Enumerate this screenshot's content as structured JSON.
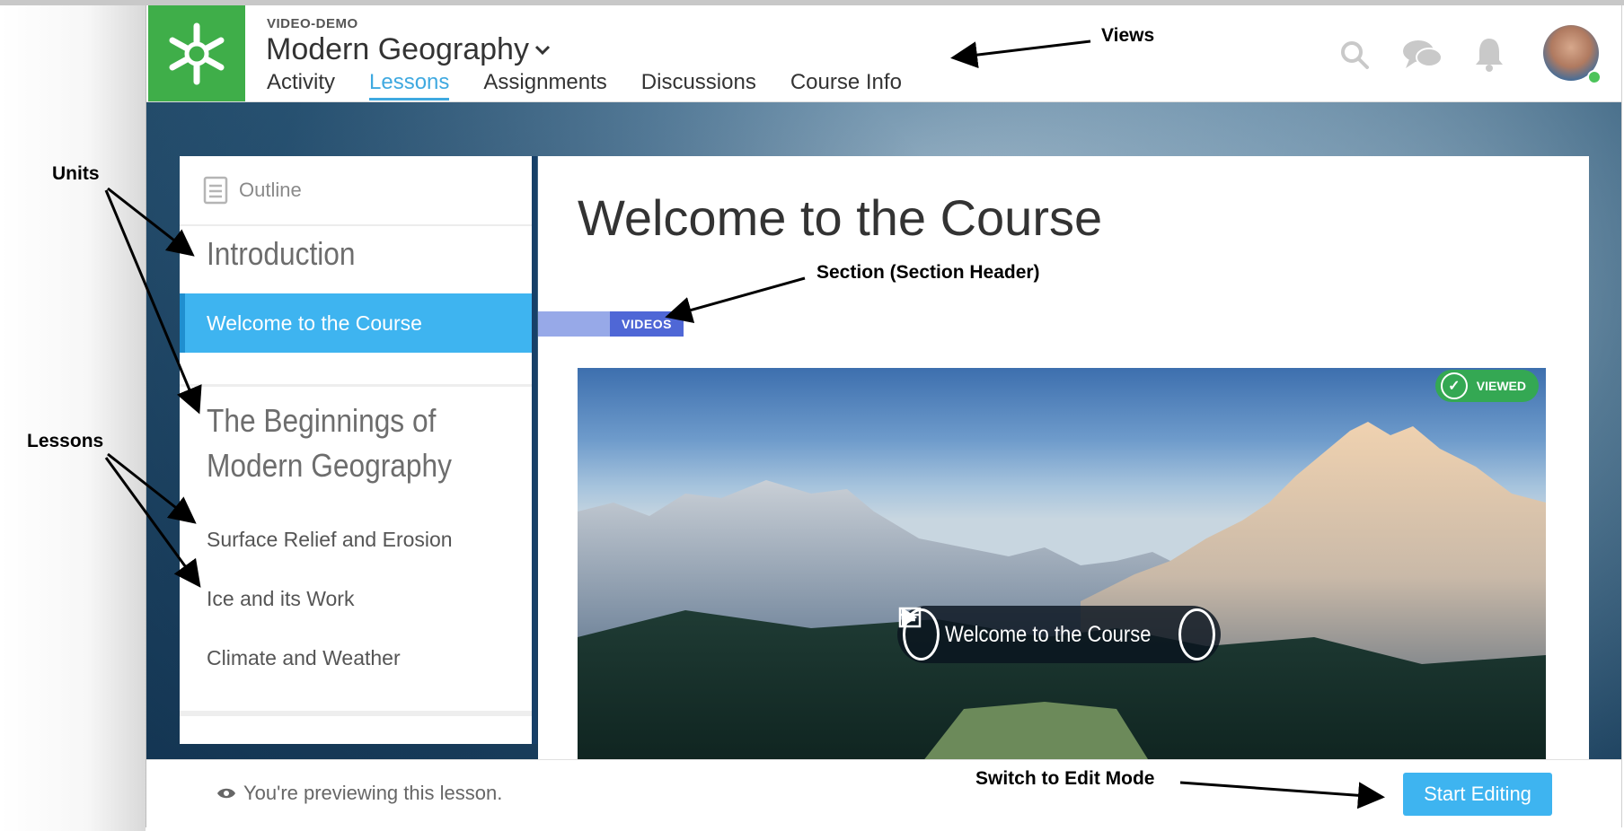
{
  "header": {
    "course_code": "VIDEO-DEMO",
    "course_title": "Modern Geography",
    "tabs": [
      {
        "label": "Activity",
        "active": false
      },
      {
        "label": "Lessons",
        "active": true
      },
      {
        "label": "Assignments",
        "active": false
      },
      {
        "label": "Discussions",
        "active": false
      },
      {
        "label": "Course Info",
        "active": false
      }
    ],
    "icons": [
      "search-icon",
      "chat-icon",
      "bell-icon",
      "avatar"
    ],
    "accent_color": "#3fa9e0",
    "logo_color": "#3fae49"
  },
  "sidebar": {
    "outline_label": "Outline",
    "units": [
      {
        "title": "Introduction",
        "lessons": [
          {
            "label": "Welcome to the Course",
            "active": true
          }
        ]
      },
      {
        "title": "The Beginnings of Modern Geography",
        "lessons": [
          {
            "label": "Surface Relief and Erosion",
            "active": false
          },
          {
            "label": "Ice and its Work",
            "active": false
          },
          {
            "label": "Climate and Weather",
            "active": false
          }
        ]
      }
    ]
  },
  "main": {
    "title": "Welcome to the Course",
    "section_tag": "VIDEOS",
    "video": {
      "badge": "VIEWED",
      "title": "Welcome to the Course"
    }
  },
  "footer": {
    "preview_message": "You're previewing this lesson.",
    "start_editing_label": "Start Editing",
    "button_color": "#3eb4f0"
  },
  "annotations": {
    "views": "Views",
    "units": "Units",
    "lessons": "Lessons",
    "section": "Section (Section Header)",
    "edit_mode": "Switch to Edit Mode"
  }
}
